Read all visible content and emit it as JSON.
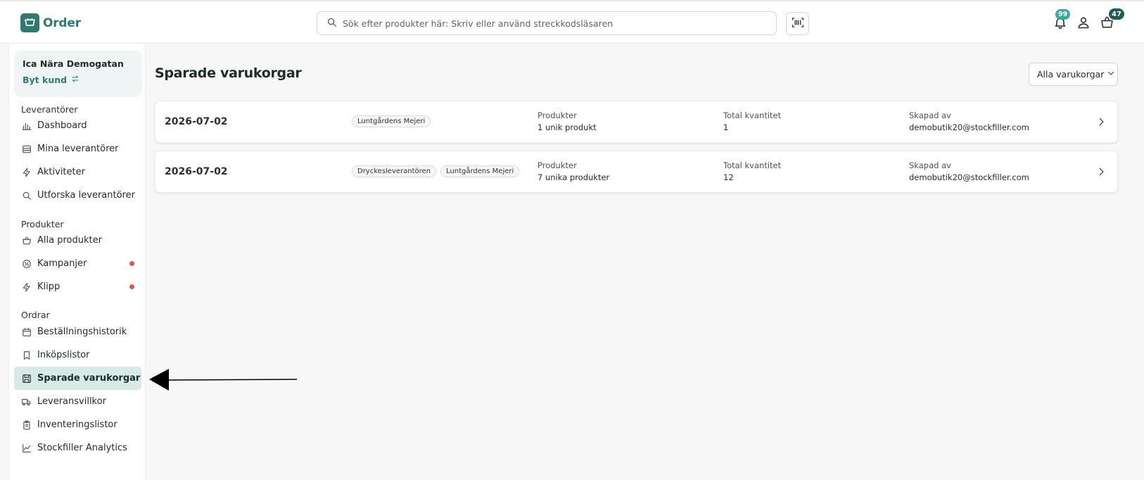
{
  "app": {
    "name": "Order",
    "brand_color": "#2e7a70"
  },
  "header": {
    "search_placeholder": "Sök efter produkter här: Skriv eller använd streckkodsläsaren",
    "notifications_count": "99",
    "cart_count": "47",
    "icons": [
      "search-icon",
      "barcode-icon",
      "bell-icon",
      "user-icon",
      "basket-icon"
    ]
  },
  "sidebar": {
    "customer": {
      "name": "Ica Nära Demogatan",
      "switch_label": "Byt kund"
    },
    "sections": [
      {
        "title": "Leverantörer",
        "items": [
          {
            "label": "Dashboard",
            "icon": "bar-chart-icon"
          },
          {
            "label": "Mina leverantörer",
            "icon": "store-icon"
          },
          {
            "label": "Aktiviteter",
            "icon": "lightning-icon"
          },
          {
            "label": "Utforska leverantörer",
            "icon": "search-icon"
          }
        ]
      },
      {
        "title": "Produkter",
        "items": [
          {
            "label": "Alla produkter",
            "icon": "basket-icon"
          },
          {
            "label": "Kampanjer",
            "icon": "discount-icon",
            "dot": true
          },
          {
            "label": "Klipp",
            "icon": "lightning-icon",
            "dot": true
          }
        ]
      },
      {
        "title": "Ordrar",
        "items": [
          {
            "label": "Beställningshistorik",
            "icon": "calendar-icon"
          },
          {
            "label": "Inköpslistor",
            "icon": "bookmark-icon"
          },
          {
            "label": "Sparade varukorgar",
            "icon": "save-icon",
            "active": true
          },
          {
            "label": "Leveransvillkor",
            "icon": "truck-icon"
          },
          {
            "label": "Inventeringslistor",
            "icon": "clipboard-icon"
          },
          {
            "label": "Stockfiller Analytics",
            "icon": "line-chart-icon"
          }
        ]
      }
    ]
  },
  "main": {
    "title": "Sparade varukorgar",
    "filter": {
      "selected": "Alla varukorgar"
    },
    "carts": [
      {
        "date": "2026-07-02",
        "suppliers": [
          "Luntgårdens Mejeri"
        ],
        "products_label": "Produkter",
        "products_value": "1 unik produkt",
        "quantity_label": "Total kvantitet",
        "quantity_value": "1",
        "created_label": "Skapad av",
        "created_value": "demobutik20@stockfiller.com"
      },
      {
        "date": "2026-07-02",
        "suppliers": [
          "Dryckesleverantören",
          "Luntgårdens Mejeri"
        ],
        "products_label": "Produkter",
        "products_value": "7 unika produkter",
        "quantity_label": "Total kvantitet",
        "quantity_value": "12",
        "created_label": "Skapad av",
        "created_value": "demobutik20@stockfiller.com"
      }
    ]
  },
  "colors": {
    "accent": "#2e7a70",
    "active_bg": "#d7eae7",
    "dot": "#e05555",
    "badge_notif": "#3aa89a",
    "badge_cart": "#1f5c55"
  }
}
